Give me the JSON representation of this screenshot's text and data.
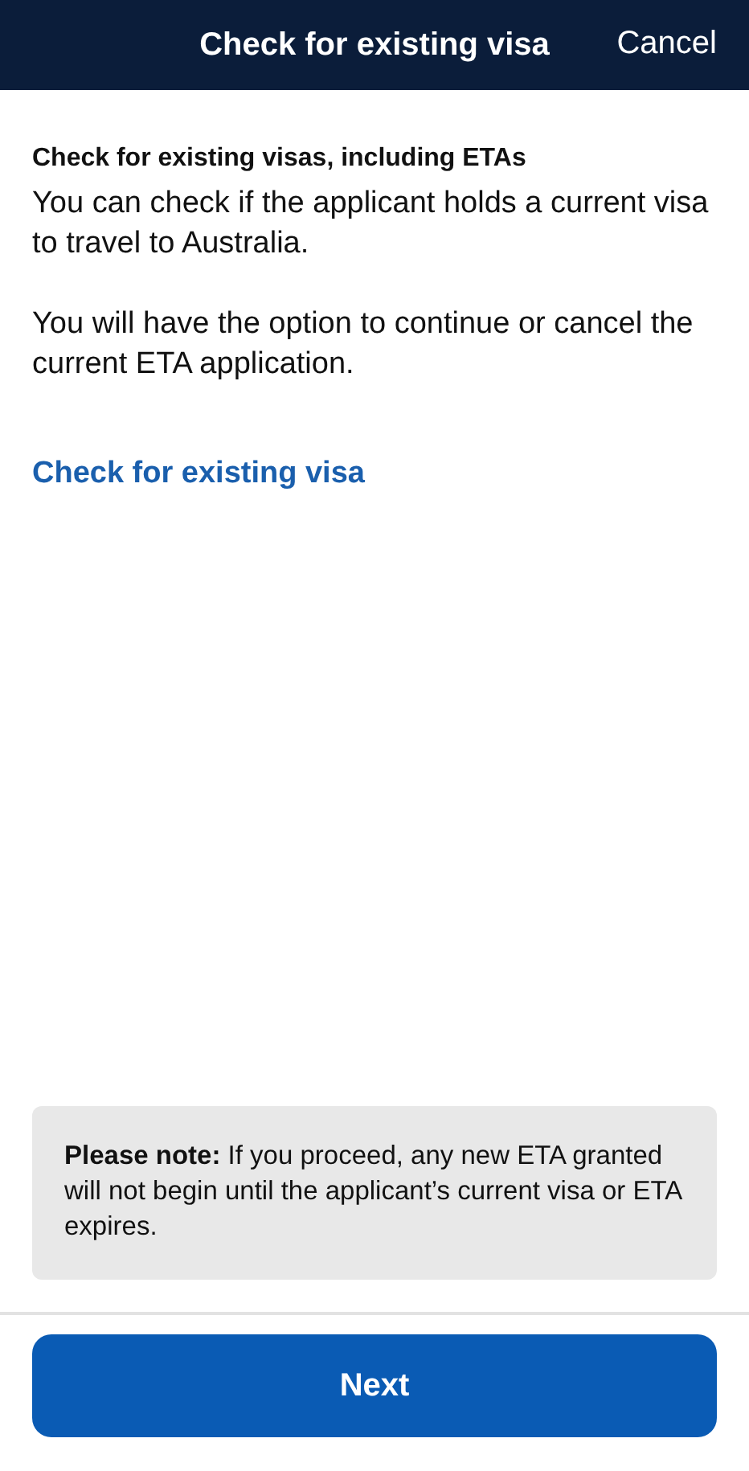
{
  "header": {
    "title": "Check for existing visa",
    "cancel": "Cancel"
  },
  "heading": "Check for existing visas, including ETAs",
  "paragraphs": [
    "You can check if the applicant holds a current visa to travel to Australia.",
    "You will have the option to continue or cancel the current ETA application."
  ],
  "link": "Check for existing visa",
  "note": "**Please note:** If you proceed, any new ETA granted will not begin until the applicant’s current visa or ETA expires.",
  "button": "Next"
}
